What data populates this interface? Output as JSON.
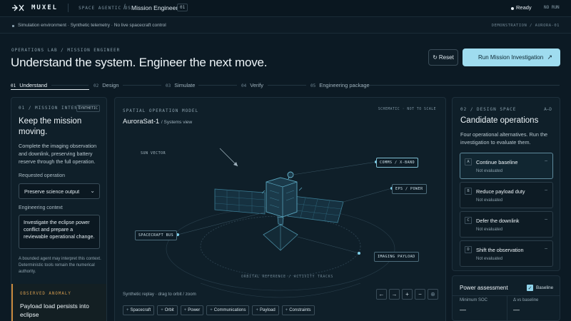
{
  "topbar": {
    "brand": "MUXEL",
    "product": "SPACE AGENTIC OS",
    "role": "Mission Engineer",
    "role_number": "01",
    "status": "Ready",
    "run_status": "NO RUN"
  },
  "notice": {
    "text": "Simulation environment · Synthetic telemetry · No live spacecraft control",
    "right": "DEMONSTRATION / AURORA-01"
  },
  "header": {
    "section": "OPERATIONS LAB / MISSION ENGINEER",
    "headline": "Understand the system. Engineer the next move.",
    "reset_label": "Reset",
    "run_label": "Run Mission Investigation"
  },
  "steps": [
    {
      "num": "01",
      "label": "Understand"
    },
    {
      "num": "02",
      "label": "Design"
    },
    {
      "num": "03",
      "label": "Simulate"
    },
    {
      "num": "04",
      "label": "Verify"
    },
    {
      "num": "05",
      "label": "Engineering package"
    }
  ],
  "intent": {
    "tag": "01 / MISSION INTENT",
    "badge": "SYNTHETIC",
    "title": "Keep the mission moving.",
    "description": "Complete the imaging observation and downlink, preserving battery reserve through the full operation.",
    "requested_label": "Requested operation",
    "requested_value": "Preserve science output",
    "context_label": "Engineering context",
    "context_value": "Investigate the eclipse power conflict and prepare a reviewable operational change.",
    "note": "A bounded agent may interpret this context. Deterministic tools remain the numerical authority.",
    "anomaly_tag": "OBSERVED ANOMALY",
    "anomaly_text": "Payload load persists into eclipse"
  },
  "model": {
    "tag": "SPATIAL OPERATION MODEL",
    "right_tag": "SCHEMATIC · NOT TO SCALE",
    "title": "AuroraSat-1",
    "subtitle": "/ Systems view",
    "sun_vector": "SUN VECTOR",
    "callouts": {
      "comms": "COMMS / X-BAND",
      "eps": "EPS / POWER",
      "bus": "SPACECRAFT BUS",
      "payload": "IMAGING PAYLOAD"
    },
    "orbit_label": "ORBITAL REFERENCE / ACTIVITY TRACKS",
    "replay": "Synthetic replay · drag to orbit / zoom",
    "controls": [
      "←",
      "→",
      "+",
      "−",
      "⊕"
    ],
    "chips": [
      "Spacecraft",
      "Orbit",
      "Power",
      "Communications",
      "Payload",
      "Constraints"
    ]
  },
  "design": {
    "tag": "02 / DESIGN SPACE",
    "right_tag": "A–D",
    "title": "Candidate operations",
    "description": "Four operational alternatives. Run the investigation to evaluate them.",
    "candidates": [
      {
        "letter": "A",
        "title": "Continue baseline",
        "status": "Not evaluated"
      },
      {
        "letter": "B",
        "title": "Reduce payload duty",
        "status": "Not evaluated"
      },
      {
        "letter": "C",
        "title": "Defer the downlink",
        "status": "Not evaluated"
      },
      {
        "letter": "D",
        "title": "Shift the observation",
        "status": "Not evaluated"
      }
    ]
  },
  "power": {
    "title": "Power assessment",
    "baseline_label": "Baseline",
    "min_soc_label": "Minimum SOC",
    "min_soc_value": "—",
    "delta_label": "Δ vs baseline",
    "delta_value": "—"
  }
}
